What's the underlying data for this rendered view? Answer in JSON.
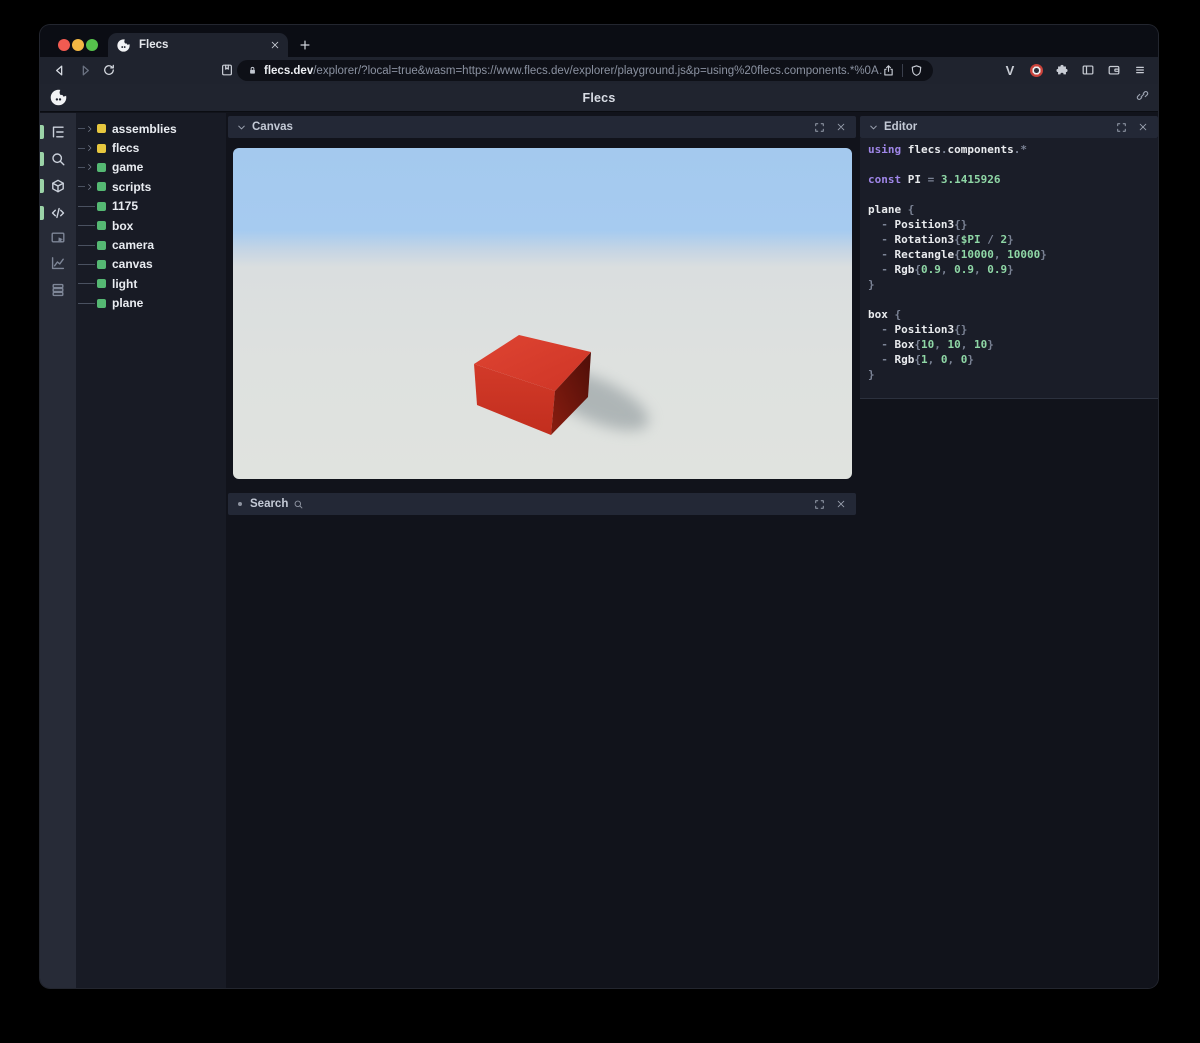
{
  "browser": {
    "tab_title": "Flecs",
    "url_domain": "flecs.dev",
    "url_path": "/explorer/?local=true&wasm=https://www.flecs.dev/explorer/playground.js&p=using%20flecs.components.*%0A…",
    "traffic_lights": [
      "#f15b51",
      "#f3b844",
      "#56c24c"
    ],
    "action_icons": [
      "vue-devtools",
      "extension-red",
      "extensions-puzzle",
      "side-panel",
      "wallet",
      "menu"
    ]
  },
  "app": {
    "title": "Flecs"
  },
  "panels": {
    "canvas": "Canvas",
    "search": "Search",
    "editor": "Editor"
  },
  "sidebar_icons": [
    {
      "name": "hierarchy",
      "active": true
    },
    {
      "name": "query-search",
      "active": true
    },
    {
      "name": "cube",
      "active": true
    },
    {
      "name": "code",
      "active": true
    },
    {
      "name": "inspector",
      "active": false
    },
    {
      "name": "stats-chart",
      "active": false
    },
    {
      "name": "journal-rows",
      "active": false
    }
  ],
  "tree": [
    {
      "label": "assemblies",
      "square": "yellow",
      "expandable": true
    },
    {
      "label": "flecs",
      "square": "yellow",
      "expandable": true
    },
    {
      "label": "game",
      "square": "green",
      "expandable": true
    },
    {
      "label": "scripts",
      "square": "green",
      "expandable": true
    },
    {
      "label": "1175",
      "square": "green",
      "expandable": false
    },
    {
      "label": "box",
      "square": "green",
      "expandable": false
    },
    {
      "label": "camera",
      "square": "green",
      "expandable": false
    },
    {
      "label": "canvas",
      "square": "green",
      "expandable": false
    },
    {
      "label": "light",
      "square": "green",
      "expandable": false
    },
    {
      "label": "plane",
      "square": "green",
      "expandable": false
    }
  ],
  "editor_code": [
    [
      [
        "kw",
        "using "
      ],
      [
        "id",
        "flecs"
      ],
      [
        "p",
        "."
      ],
      [
        "id",
        "components"
      ],
      [
        "p",
        ".*"
      ]
    ],
    [],
    [
      [
        "kw",
        "const "
      ],
      [
        "id",
        "PI "
      ],
      [
        "p",
        "= "
      ],
      [
        "num",
        "3.1415926"
      ]
    ],
    [],
    [
      [
        "id",
        "plane "
      ],
      [
        "p",
        "{"
      ]
    ],
    [
      [
        "p",
        "  - "
      ],
      [
        "id",
        "Position3"
      ],
      [
        "p",
        "{}"
      ]
    ],
    [
      [
        "p",
        "  - "
      ],
      [
        "id",
        "Rotation3"
      ],
      [
        "p",
        "{"
      ],
      [
        "num",
        "$PI"
      ],
      [
        "p",
        " / "
      ],
      [
        "num",
        "2"
      ],
      [
        "p",
        "}"
      ]
    ],
    [
      [
        "p",
        "  - "
      ],
      [
        "id",
        "Rectangle"
      ],
      [
        "p",
        "{"
      ],
      [
        "num",
        "10000"
      ],
      [
        "p",
        ", "
      ],
      [
        "num",
        "10000"
      ],
      [
        "p",
        "}"
      ]
    ],
    [
      [
        "p",
        "  - "
      ],
      [
        "id",
        "Rgb"
      ],
      [
        "p",
        "{"
      ],
      [
        "num",
        "0.9"
      ],
      [
        "p",
        ", "
      ],
      [
        "num",
        "0.9"
      ],
      [
        "p",
        ", "
      ],
      [
        "num",
        "0.9"
      ],
      [
        "p",
        "}"
      ]
    ],
    [
      [
        "p",
        "}"
      ]
    ],
    [],
    [
      [
        "id",
        "box "
      ],
      [
        "p",
        "{"
      ]
    ],
    [
      [
        "p",
        "  - "
      ],
      [
        "id",
        "Position3"
      ],
      [
        "p",
        "{}"
      ]
    ],
    [
      [
        "p",
        "  - "
      ],
      [
        "id",
        "Box"
      ],
      [
        "p",
        "{"
      ],
      [
        "num",
        "10"
      ],
      [
        "p",
        ", "
      ],
      [
        "num",
        "10"
      ],
      [
        "p",
        ", "
      ],
      [
        "num",
        "10"
      ],
      [
        "p",
        "}"
      ]
    ],
    [
      [
        "p",
        "  - "
      ],
      [
        "id",
        "Rgb"
      ],
      [
        "p",
        "{"
      ],
      [
        "num",
        "1"
      ],
      [
        "p",
        ", "
      ],
      [
        "num",
        "0"
      ],
      [
        "p",
        ", "
      ],
      [
        "num",
        "0"
      ],
      [
        "p",
        "}"
      ]
    ],
    [
      [
        "p",
        "}"
      ]
    ]
  ],
  "scene": {
    "sky_color": "#a5caef",
    "ground_color": "#dfe2df",
    "box_top_color": "#d73b2a",
    "box_front_color": "#c93323",
    "box_side_color": "#5c120b"
  },
  "colors": {
    "accent_green_indicator": "#9bd3a7",
    "tree_square_green": "#55b873",
    "tree_square_yellow": "#e7c73f",
    "code_keyword": "#9f86e8",
    "code_number": "#8fd7a6"
  }
}
